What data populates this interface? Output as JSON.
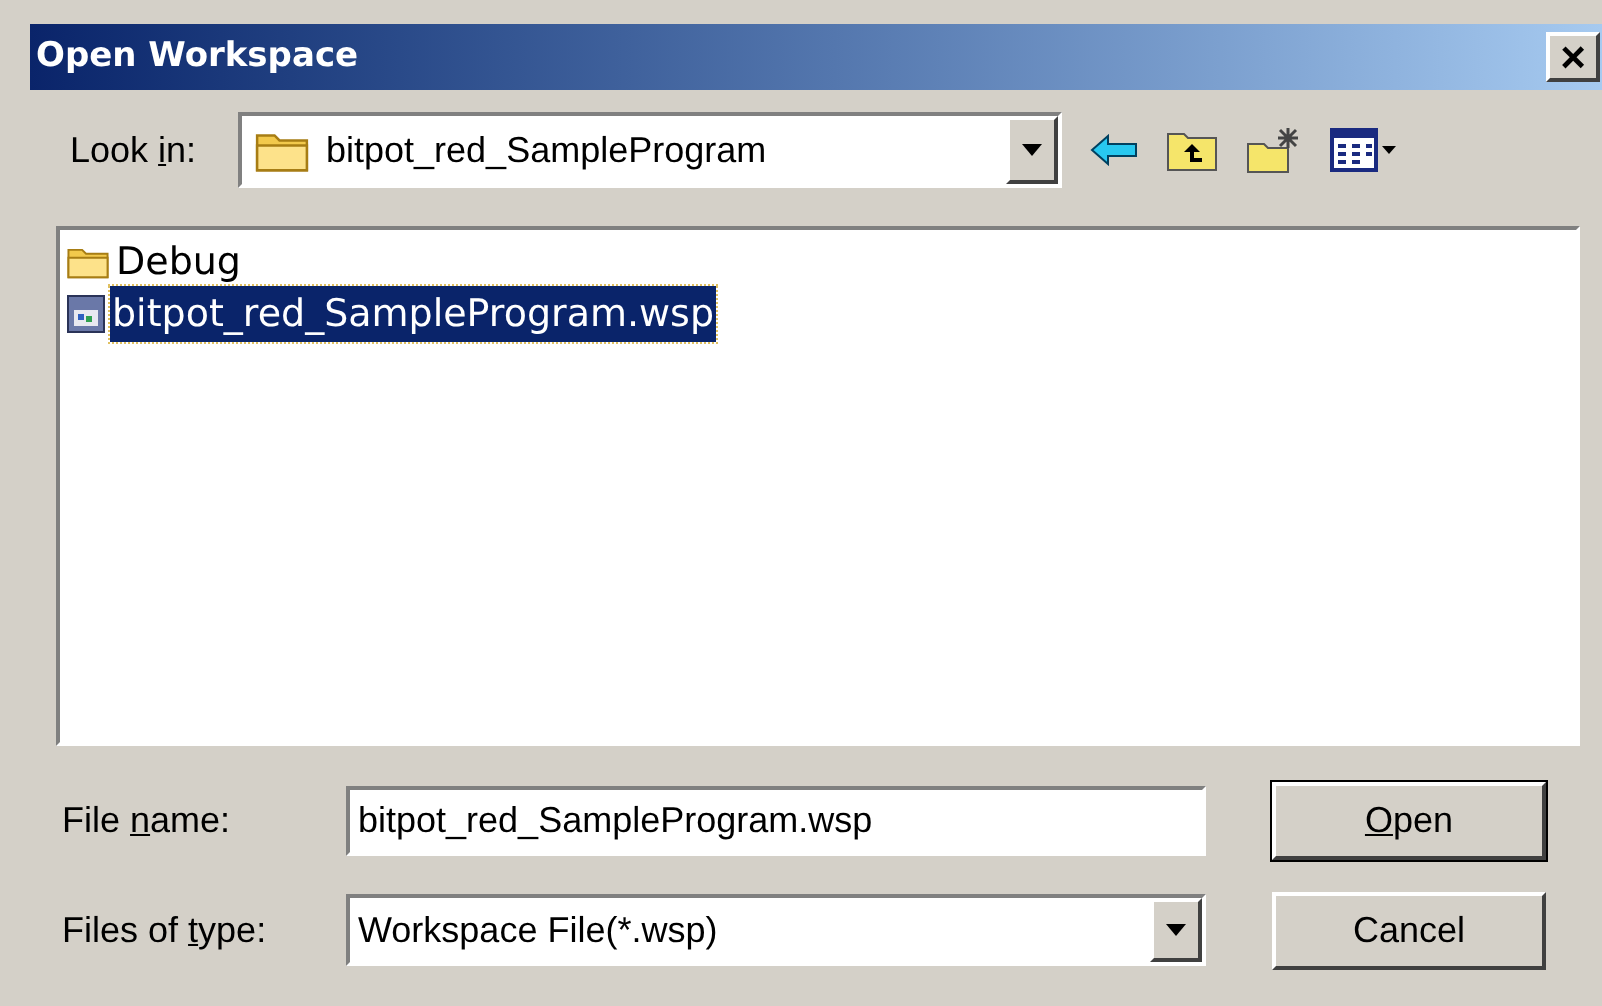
{
  "window": {
    "title": "Open Workspace",
    "close": "×"
  },
  "look_in": {
    "label": {
      "before": "Look ",
      "key": "i",
      "after": "n:"
    },
    "value": "bitpot_red_SampleProgram"
  },
  "files": [
    {
      "kind": "folder",
      "name": "Debug",
      "selected": false
    },
    {
      "kind": "workspace",
      "name": "bitpot_red_SampleProgram.wsp",
      "selected": true
    }
  ],
  "file_name": {
    "label": {
      "before": "File ",
      "key": "n",
      "after": "ame:"
    },
    "value": "bitpot_red_SampleProgram.wsp"
  },
  "file_type": {
    "label": {
      "before": "Files of ",
      "key": "t",
      "after": "ype:"
    },
    "value": "Workspace File(*.wsp)"
  },
  "buttons": [
    {
      "label": {
        "key": "O",
        "after": "pen"
      },
      "default": true
    },
    {
      "label": {
        "before": "Cancel"
      },
      "default": false
    }
  ]
}
